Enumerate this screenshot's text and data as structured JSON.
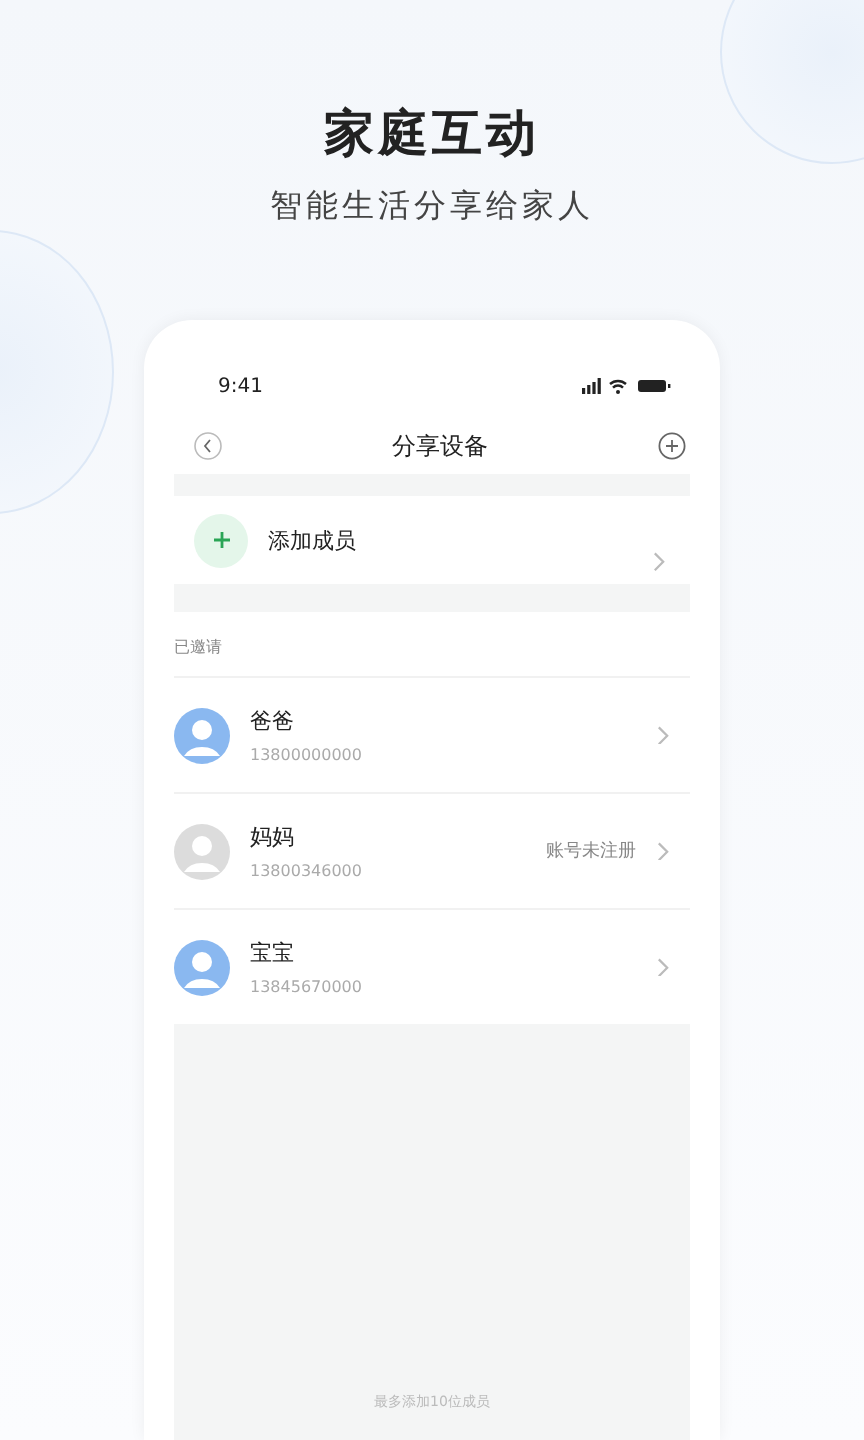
{
  "hero": {
    "title": "家庭互动",
    "subtitle": "智能生活分享给家人"
  },
  "status_bar": {
    "time": "9:41"
  },
  "nav": {
    "title": "分享设备"
  },
  "add_member": {
    "label": "添加成员"
  },
  "section": {
    "title": "已邀请"
  },
  "members": [
    {
      "name": "爸爸",
      "phone": "13800000000",
      "registered": true
    },
    {
      "name": "妈妈",
      "phone": "13800346000",
      "registered": false,
      "status": "账号未注册"
    },
    {
      "name": "宝宝",
      "phone": "13845670000",
      "registered": true
    }
  ],
  "footer_note": "最多添加10位成员"
}
